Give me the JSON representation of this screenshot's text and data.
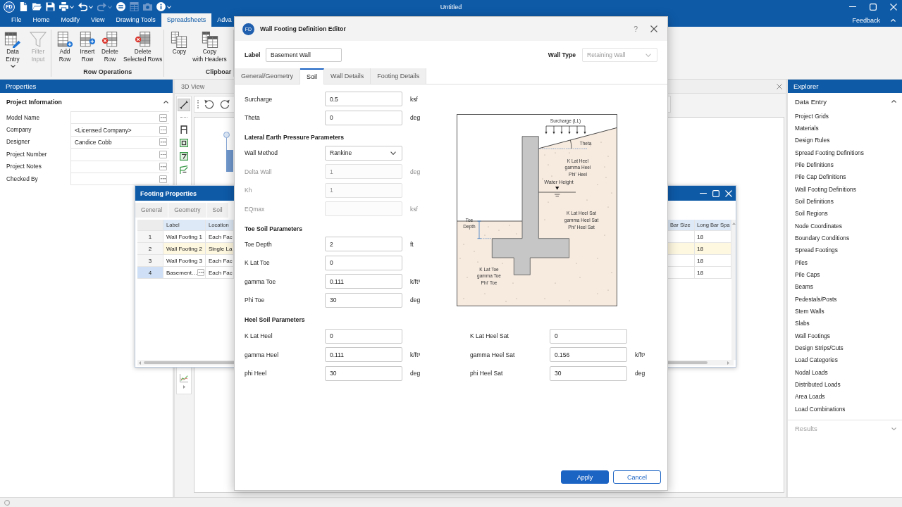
{
  "window": {
    "logo": "FD",
    "title": "Untitled"
  },
  "quick_access": [
    {
      "kind": "new",
      "disabled": false,
      "dropdown": false
    },
    {
      "kind": "open",
      "disabled": false,
      "dropdown": false
    },
    {
      "kind": "save",
      "disabled": false,
      "dropdown": false
    },
    {
      "kind": "print",
      "disabled": false,
      "dropdown": true
    },
    {
      "kind": "undo",
      "disabled": false,
      "dropdown": true
    },
    {
      "kind": "redo",
      "disabled": true,
      "dropdown": true
    },
    {
      "kind": "equals",
      "disabled": false,
      "dropdown": false
    },
    {
      "kind": "grid",
      "disabled": true,
      "dropdown": false
    },
    {
      "kind": "camera",
      "disabled": true,
      "dropdown": false
    },
    {
      "kind": "info",
      "disabled": false,
      "dropdown": true
    }
  ],
  "menu": [
    {
      "label": "File",
      "selected": false
    },
    {
      "label": "Home",
      "selected": false
    },
    {
      "label": "Modify",
      "selected": false
    },
    {
      "label": "View",
      "selected": false
    },
    {
      "label": "Drawing Tools",
      "selected": false
    },
    {
      "label": "Spreadsheets",
      "selected": true
    },
    {
      "label": "Adva",
      "selected": false
    }
  ],
  "feedback": "Feedback",
  "ribbon": [
    {
      "buttons": [
        {
          "kind": "data_entry",
          "lines": [
            "Data",
            "Entry"
          ],
          "dropdown": true,
          "disabled": false
        },
        {
          "kind": "filter",
          "lines": [
            "Filter",
            "Input"
          ],
          "dropdown": false,
          "disabled": true
        }
      ]
    },
    {
      "label": "Row Operations",
      "buttons": [
        {
          "kind": "add_row",
          "lines": [
            "Add",
            "Row"
          ],
          "dropdown": false,
          "disabled": false
        },
        {
          "kind": "insert_row",
          "lines": [
            "Insert",
            "Row"
          ],
          "dropdown": false,
          "disabled": false
        },
        {
          "kind": "delete_row",
          "lines": [
            "Delete",
            "Row"
          ],
          "dropdown": false,
          "disabled": false
        },
        {
          "kind": "delete_selected",
          "lines": [
            "Delete",
            "Selected Rows"
          ],
          "dropdown": false,
          "disabled": false
        }
      ]
    },
    {
      "label": "Clipboar",
      "buttons": [
        {
          "kind": "copy",
          "lines": [
            "Copy"
          ],
          "dropdown": false,
          "disabled": false
        },
        {
          "kind": "copy_headers",
          "lines": [
            "Copy",
            "with Headers"
          ],
          "dropdown": false,
          "disabled": false
        }
      ]
    }
  ],
  "properties": {
    "title": "Properties",
    "section": {
      "title": "Project Information",
      "expanded": true,
      "fields": [
        {
          "label": "Model Name"
        },
        {
          "label": "Company",
          "value": "<Licensed Company>"
        },
        {
          "label": "Designer",
          "value": "Candice Cobb"
        },
        {
          "label": "Project Number"
        },
        {
          "label": "Project Notes"
        },
        {
          "label": "Checked By"
        }
      ]
    }
  },
  "view_panel": {
    "title": "3D View",
    "tool_groups": [
      [
        {
          "kind": "line",
          "selected": true
        }
      ],
      [
        {
          "kind": "frame",
          "selected": false
        },
        {
          "kind": "slab",
          "selected": false
        },
        {
          "kind": "region",
          "selected": false
        },
        {
          "kind": "polyline",
          "selected": false
        }
      ],
      [
        {
          "kind": "chart",
          "selected": false
        }
      ]
    ]
  },
  "explorer": {
    "title": "Explorer",
    "sections": [
      {
        "title": "Data Entry",
        "expanded": true,
        "disabled": false,
        "items": [
          {
            "label": "Project Grids",
            "selected": false
          },
          {
            "label": "Materials",
            "selected": false
          },
          {
            "label": "Design Rules",
            "selected": false
          },
          {
            "label": "Spread Footing Definitions",
            "selected": false
          },
          {
            "label": "Pile Definitions",
            "selected": false
          },
          {
            "label": "Pile Cap Definitions",
            "selected": false
          },
          {
            "label": "Wall Footing Definitions",
            "selected": false
          },
          {
            "label": "Soil Definitions",
            "selected": false
          },
          {
            "label": "Soil Regions",
            "selected": false
          },
          {
            "label": "Node Coordinates",
            "selected": false
          },
          {
            "label": "Boundary Conditions",
            "selected": false
          },
          {
            "label": "Spread Footings",
            "selected": false
          },
          {
            "label": "Piles",
            "selected": false
          },
          {
            "label": "Pile Caps",
            "selected": false
          },
          {
            "label": "Beams",
            "selected": false
          },
          {
            "label": "Pedestals/Posts",
            "selected": false
          },
          {
            "label": "Stem Walls",
            "selected": false
          },
          {
            "label": "Slabs",
            "selected": false
          },
          {
            "label": "Wall Footings",
            "selected": false
          },
          {
            "label": "Design Strips/Cuts",
            "selected": false
          },
          {
            "label": "Load Categories",
            "selected": false
          },
          {
            "label": "Nodal Loads",
            "selected": false
          },
          {
            "label": "Distributed Loads",
            "selected": false
          },
          {
            "label": "Area Loads",
            "selected": false
          },
          {
            "label": "Load Combinations",
            "selected": false
          }
        ]
      },
      {
        "title": "Results",
        "expanded": false,
        "disabled": true
      }
    ]
  },
  "footing_window": {
    "title": "Footing Properties",
    "tabs": [
      {
        "label": "General",
        "selected": false
      },
      {
        "label": "Geometry",
        "selected": false
      },
      {
        "label": "Soil",
        "selected": false
      }
    ],
    "columns": {
      "label": "Label",
      "location": "Location",
      "bar_size": "Bar Size",
      "long_bar_spa": "Long Bar Spa"
    },
    "rows": [
      {
        "number": "1",
        "label": "Wall Footing 1",
        "location": "Each Fac",
        "long_bar_spa": "18",
        "highlighted": false,
        "selected": false
      },
      {
        "number": "2",
        "label": "Wall Footing 2",
        "location": "Single La",
        "long_bar_spa": "18",
        "highlighted": true,
        "selected": false
      },
      {
        "number": "3",
        "label": "Wall Footing 3",
        "location": "Each Fac",
        "long_bar_spa": "18",
        "highlighted": false,
        "selected": false
      },
      {
        "number": "4",
        "label": "Basement…",
        "location": "Each Fac",
        "long_bar_spa": "18",
        "highlighted": false,
        "selected": true
      }
    ]
  },
  "dialog": {
    "logo": "FD",
    "title": "Wall Footing Definition Editor",
    "help": "?",
    "label": {
      "caption": "Label",
      "value": "Basement Wall"
    },
    "wall_type": {
      "caption": "Wall Type",
      "value": "Retaining Wall",
      "disabled": true
    },
    "tabs": [
      {
        "label": "General/Geometry",
        "selected": false
      },
      {
        "label": "Soil",
        "selected": true
      },
      {
        "label": "Wall Details",
        "selected": false
      },
      {
        "label": "Footing Details",
        "selected": false
      }
    ],
    "soil_fields": [
      {
        "kind": "input",
        "label": "Surcharge",
        "value": "0.5",
        "unit": "ksf",
        "disabled": false
      },
      {
        "kind": "input",
        "label": "Theta",
        "value": "0",
        "unit": "deg",
        "disabled": false
      },
      {
        "kind": "heading",
        "label": "Lateral Earth Pressure Parameters"
      },
      {
        "kind": "select",
        "label": "Wall Method",
        "value": "Rankine",
        "disabled": false
      },
      {
        "kind": "input",
        "label": "Delta Wall",
        "value": "1",
        "unit": "deg",
        "disabled": true
      },
      {
        "kind": "input",
        "label": "Kh",
        "value": "1",
        "disabled": true
      },
      {
        "kind": "input",
        "label": "EQmax",
        "unit": "ksf",
        "disabled": true
      },
      {
        "kind": "heading",
        "label": "Toe Soil Parameters"
      },
      {
        "kind": "input",
        "label": "Toe Depth",
        "value": "2",
        "unit": "ft",
        "disabled": false
      },
      {
        "kind": "input",
        "label": "K Lat Toe",
        "value": "0",
        "disabled": false
      },
      {
        "kind": "input",
        "label": "gamma Toe",
        "value": "0.111",
        "unit": "k/ft³",
        "disabled": false
      },
      {
        "kind": "input",
        "label": "Phi Toe",
        "value": "30",
        "unit": "deg",
        "disabled": false
      }
    ],
    "diagram": {
      "labels": [
        {
          "lines": [
            "Surcharge (LL)"
          ]
        },
        {
          "lines": [
            "Theta"
          ]
        },
        {
          "lines": [
            "K Lat Heel",
            "gamma Heel",
            "Phi' Heel"
          ]
        },
        {
          "lines": [
            "Water Height"
          ]
        },
        {
          "lines": [
            "Toe",
            "Depth"
          ]
        },
        {
          "lines": [
            "K Lat Heel Sat",
            "gamma Heel Sat",
            "Phi' Heel Sat"
          ]
        },
        {
          "lines": [
            "K Lat Toe",
            "gamma Toe",
            "Phi' Toe"
          ]
        }
      ]
    },
    "heel": {
      "heading": "Heel Soil Parameters",
      "fields": [
        {
          "kind": "input",
          "label": "K Lat Heel",
          "value": "0",
          "disabled": false
        },
        {
          "kind": "input",
          "label": "K Lat Heel Sat",
          "value": "0",
          "disabled": false
        },
        {
          "kind": "input",
          "label": "gamma Heel",
          "value": "0.111",
          "unit": "k/ft³",
          "disabled": false
        },
        {
          "kind": "input",
          "label": "gamma Heel Sat",
          "value": "0.156",
          "unit": "k/ft³",
          "disabled": false
        },
        {
          "kind": "input",
          "label": "phi Heel",
          "value": "30",
          "unit": "deg",
          "disabled": false
        },
        {
          "kind": "input",
          "label": "phi Heel Sat",
          "value": "30",
          "unit": "deg",
          "disabled": false
        }
      ]
    },
    "buttons": [
      {
        "kind": "primary",
        "label": "Apply"
      },
      {
        "kind": "secondary",
        "label": "Cancel"
      }
    ]
  }
}
